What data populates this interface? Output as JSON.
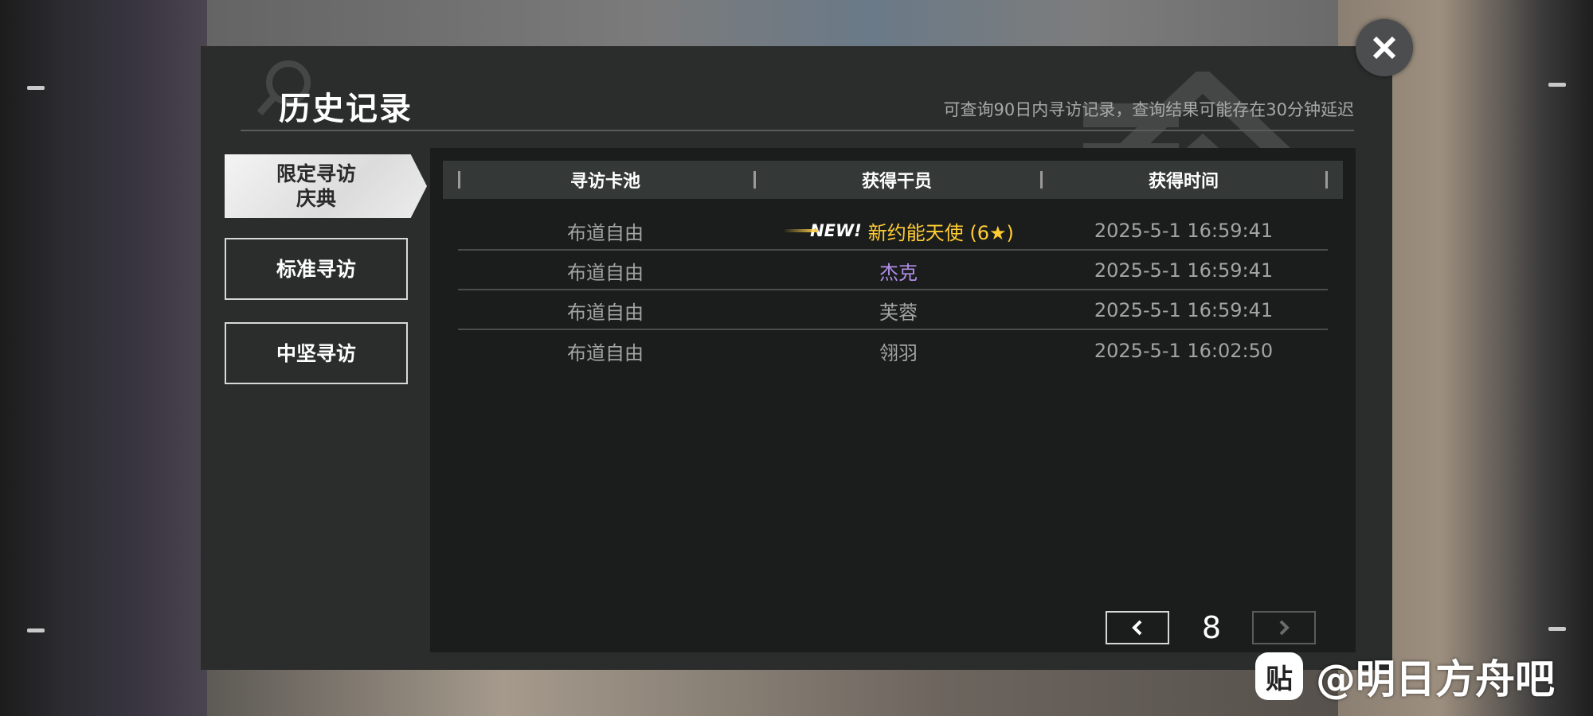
{
  "modal": {
    "title": "历史记录",
    "subtitle": "可查询90日内寻访记录，查询结果可能存在30分钟延迟"
  },
  "sidebar": {
    "tabs": [
      {
        "label_line1": "限定寻访",
        "label_line2": "庆典",
        "active": true
      },
      {
        "label": "标准寻访",
        "active": false
      },
      {
        "label": "中坚寻访",
        "active": false
      }
    ]
  },
  "table": {
    "headers": [
      "寻访卡池",
      "获得干员",
      "获得时间"
    ],
    "rows": [
      {
        "pool": "布道自由",
        "new_badge": "NEW!",
        "operator": "新约能天使 (6★)",
        "time": "2025-5-1 16:59:41",
        "color": "#ffcc33"
      },
      {
        "pool": "布道自由",
        "new_badge": "",
        "operator": "杰克",
        "time": "2025-5-1 16:59:41",
        "color": "#b18ee8"
      },
      {
        "pool": "布道自由",
        "new_badge": "",
        "operator": "芙蓉",
        "time": "2025-5-1 16:59:41",
        "color": "#a3a3a3"
      },
      {
        "pool": "布道自由",
        "new_badge": "",
        "operator": "翎羽",
        "time": "2025-5-1 16:02:50",
        "color": "#a3a3a3"
      }
    ]
  },
  "pagination": {
    "page": "8",
    "prev_icon": "chevron-left-icon",
    "next_icon": "chevron-right-icon",
    "next_enabled": false
  },
  "close_icon": "close-icon",
  "watermark": {
    "icon_glyph": "贴",
    "text": "@明日方舟吧"
  }
}
